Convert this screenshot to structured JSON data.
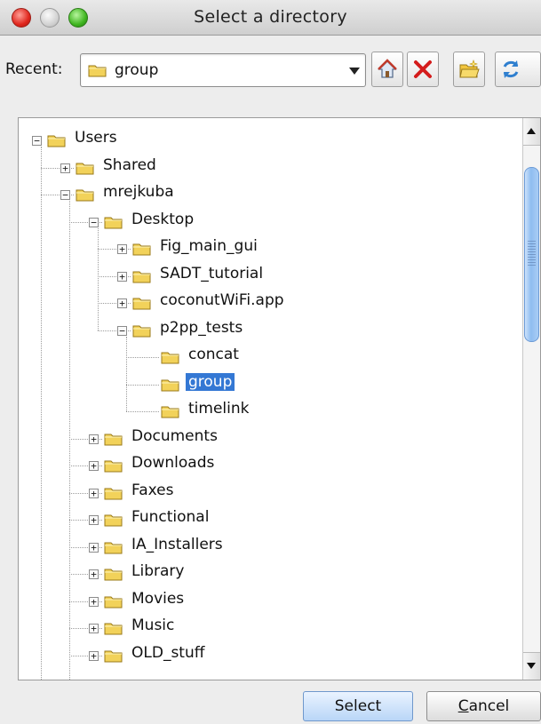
{
  "window": {
    "title": "Select a directory"
  },
  "toolbar": {
    "recent_label": "Recent:",
    "recent_value": "group",
    "buttons": [
      {
        "icon": "home-icon"
      },
      {
        "icon": "delete-icon"
      },
      {
        "icon": "new-folder-icon"
      },
      {
        "icon": "refresh-icon"
      }
    ]
  },
  "tree": {
    "items": [
      {
        "label": "Users",
        "depth": 0,
        "expander": "minus"
      },
      {
        "label": "Shared",
        "depth": 1,
        "expander": "plus"
      },
      {
        "label": "mrejkuba",
        "depth": 1,
        "expander": "minus"
      },
      {
        "label": "Desktop",
        "depth": 2,
        "expander": "minus"
      },
      {
        "label": "Fig_main_gui",
        "depth": 3,
        "expander": "plus"
      },
      {
        "label": "SADT_tutorial",
        "depth": 3,
        "expander": "plus"
      },
      {
        "label": "coconutWiFi.app",
        "depth": 3,
        "expander": "plus"
      },
      {
        "label": "p2pp_tests",
        "depth": 3,
        "expander": "minus"
      },
      {
        "label": "concat",
        "depth": 4,
        "expander": "none"
      },
      {
        "label": "group",
        "depth": 4,
        "expander": "none",
        "selected": true
      },
      {
        "label": "timelink",
        "depth": 4,
        "expander": "none"
      },
      {
        "label": "Documents",
        "depth": 2,
        "expander": "plus"
      },
      {
        "label": "Downloads",
        "depth": 2,
        "expander": "plus"
      },
      {
        "label": "Faxes",
        "depth": 2,
        "expander": "plus"
      },
      {
        "label": "Functional",
        "depth": 2,
        "expander": "plus"
      },
      {
        "label": "IA_Installers",
        "depth": 2,
        "expander": "plus"
      },
      {
        "label": "Library",
        "depth": 2,
        "expander": "plus"
      },
      {
        "label": "Movies",
        "depth": 2,
        "expander": "plus"
      },
      {
        "label": "Music",
        "depth": 2,
        "expander": "plus"
      },
      {
        "label": "OLD_stuff",
        "depth": 2,
        "expander": "plus"
      }
    ]
  },
  "buttons": {
    "select": "Select",
    "cancel_underlined": "C",
    "cancel_rest": "ancel"
  },
  "colors": {
    "selection": "#3478d4",
    "folder": "#f2d25a"
  }
}
